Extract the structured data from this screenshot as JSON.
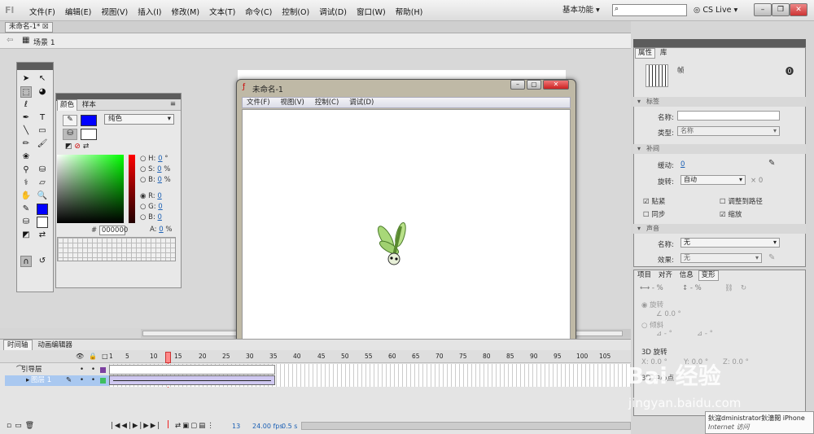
{
  "app": {
    "logo": "Fl",
    "menu": [
      "文件(F)",
      "编辑(E)",
      "视图(V)",
      "插入(I)",
      "修改(M)",
      "文本(T)",
      "命令(C)",
      "控制(O)",
      "调试(D)",
      "窗口(W)",
      "帮助(H)"
    ],
    "workspace": "基本功能",
    "cs_live": "CS Live"
  },
  "document": {
    "tab": "未命名-1*",
    "scene": "场景 1",
    "zoom": "100%"
  },
  "color_panel": {
    "tabs": [
      "颜色",
      "样本"
    ],
    "fill_type": "纯色",
    "hex": "000000",
    "h": {
      "label": "H:",
      "value": "0",
      "unit": "°"
    },
    "s": {
      "label": "S:",
      "value": "0",
      "unit": "%"
    },
    "b": {
      "label": "B:",
      "value": "0",
      "unit": "%"
    },
    "r": {
      "label": "R:",
      "value": "0"
    },
    "g": {
      "label": "G:",
      "value": "0"
    },
    "bl": {
      "label": "B:",
      "value": "0"
    },
    "a": {
      "label": "A:",
      "value": "0",
      "unit": "%"
    },
    "hash": "#"
  },
  "flash_player": {
    "title": "未命名-1",
    "menu": [
      "文件(F)",
      "视图(V)",
      "控制(C)",
      "调试(D)"
    ]
  },
  "timeline": {
    "tabs": [
      "时间轴",
      "动画编辑器"
    ],
    "ruler": [
      "1",
      "5",
      "10",
      "15",
      "20",
      "25",
      "30",
      "35",
      "40",
      "45",
      "50",
      "55",
      "60",
      "65",
      "70",
      "75",
      "80",
      "85",
      "90",
      "95",
      "100",
      "105"
    ],
    "layers": [
      {
        "name": "引导层"
      },
      {
        "name": "图层 1"
      }
    ],
    "current_frame": "13",
    "fps": "24.00 fps",
    "time": "0.5 s"
  },
  "properties": {
    "tabs": [
      "属性",
      "库"
    ],
    "object": "帧",
    "sec_label": "标签",
    "name_label": "名称:",
    "type_label": "类型:",
    "type_value": "名称",
    "sec_tween": "补间",
    "ease_label": "缓动:",
    "ease_value": "0",
    "rotate_label": "旋转:",
    "rotate_value": "自动",
    "rotate_count": "0",
    "times": "×",
    "chk_snap": "贴紧",
    "chk_orient": "调整到路径",
    "chk_sync": "同步",
    "chk_scale": "缩放",
    "sec_sound": "声音",
    "sound_name_label": "名称:",
    "sound_name": "无",
    "effect_label": "效果:",
    "effect_value": "无"
  },
  "transform": {
    "tabs": [
      "项目",
      "对齐",
      "信息",
      "变形"
    ],
    "w_pct": "- %",
    "h_pct": "- %",
    "rotate": "旋转",
    "rotate_val": "0.0 °",
    "skew": "倾斜",
    "skew_val1": "- °",
    "skew_val2": "- °",
    "rot3d": "3D 旋转",
    "x_label": "X:",
    "x_val": "0.0 °",
    "y_label": "Y:",
    "y_val": "0.0 °",
    "z_label": "Z:",
    "z_val": "0.0 °",
    "center_label": "3D 中心点"
  },
  "watermark": {
    "text": "Bai 经验",
    "url": "jingyan.baidu.com"
  },
  "tooltip": {
    "line1": "鈥滱dministrator鈥濇閲 iPhone",
    "line2": "Internet 访问"
  }
}
